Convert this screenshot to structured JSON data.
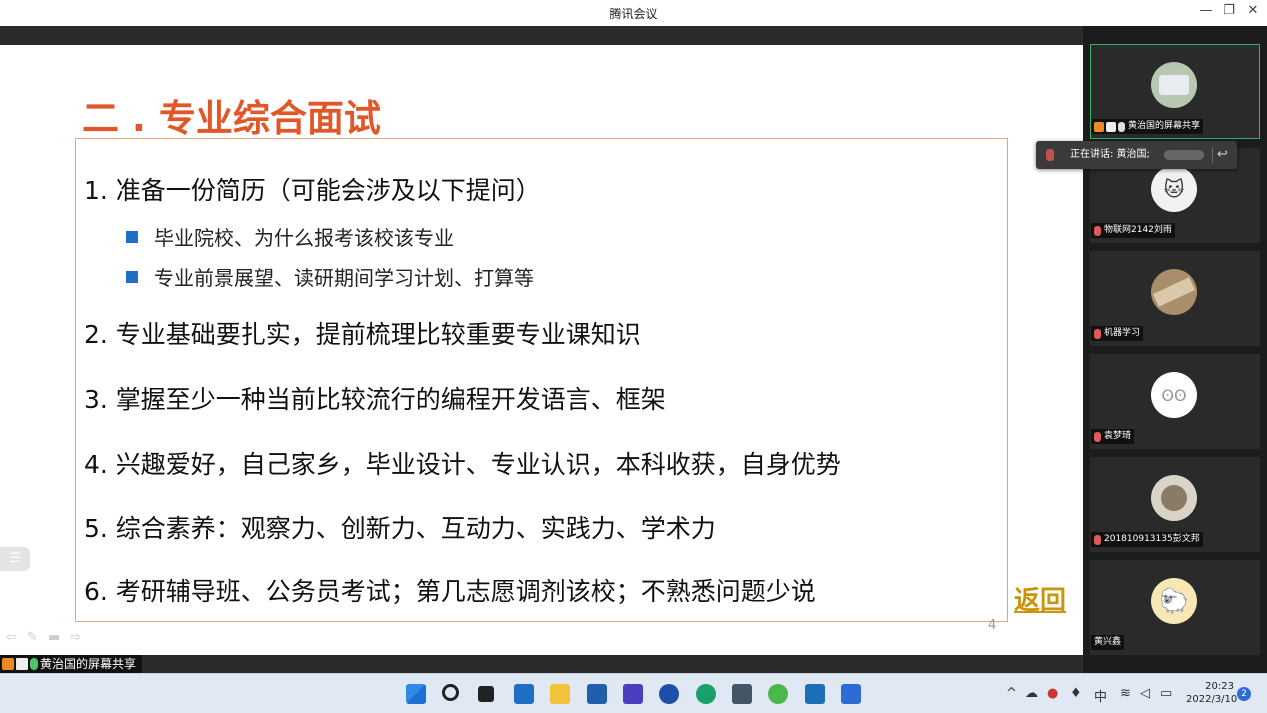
{
  "window": {
    "title": "腾讯会议",
    "minimize": "—",
    "restore": "❐",
    "close": "✕"
  },
  "slide": {
    "title": "二 . 专业综合面试",
    "items": [
      "1.  准备一份简历（可能会涉及以下提问）",
      "2.  专业基础要扎实，提前梳理比较重要专业课知识",
      "3.  掌握至少一种当前比较流行的编程开发语言、框架",
      "4.  兴趣爱好，自己家乡，毕业设计、专业认识，本科收获，自身优势",
      "5.  综合素养：观察力、创新力、互动力、实践力、学术力",
      "6.  考研辅导班、公务员考试；第几志愿调剂该校；不熟悉问题少说"
    ],
    "subitems": [
      "毕业院校、为什么报考该校该专业",
      "专业前景展望、读研期间学习计划、打算等"
    ],
    "back_link": "返回",
    "page_number": "4"
  },
  "share_bar": {
    "sharer_label": "黄治国的屏幕共享"
  },
  "speaking": {
    "text": "正在讲话: 黄治国;",
    "reply_icon": "reply-icon"
  },
  "participants": [
    {
      "name": "黄治国的屏幕共享",
      "avatar": "photo"
    },
    {
      "name": "物联网2142刘雨",
      "avatar": "cat"
    },
    {
      "name": "机器学习",
      "avatar": "photo"
    },
    {
      "name": "袁梦琦",
      "avatar": "cartoon"
    },
    {
      "name": "201810913135彭文邦",
      "avatar": "photo"
    },
    {
      "name": "黄兴鑫",
      "avatar": "sheep"
    }
  ],
  "taskbar": {
    "tray_lang": "中",
    "time": "20:23",
    "date": "2022/3/10",
    "notifications": "2"
  },
  "colors": {
    "title_orange": "#e2572a",
    "bullet_blue": "#1f6fc4",
    "back_gold": "#c9950c",
    "active_green": "#2fb36a"
  }
}
